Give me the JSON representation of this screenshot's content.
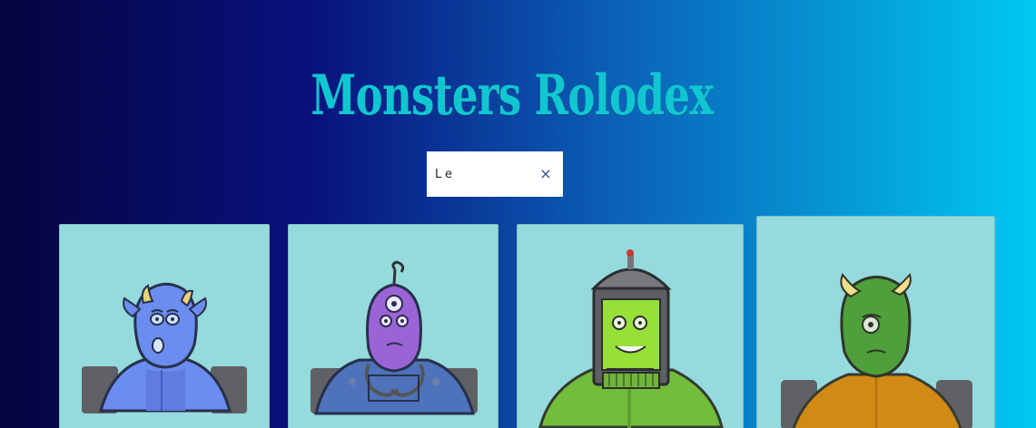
{
  "app": {
    "title": "Monsters Rolodex"
  },
  "search": {
    "value": "Le",
    "clear_symbol": "×"
  },
  "colors": {
    "title": "#10c7d0",
    "card_background": "#95dadd"
  },
  "cards": [
    {
      "image_icon": "monster-blue-image",
      "image_alt": ""
    },
    {
      "image_icon": "monster-purple-image",
      "image_alt": ""
    },
    {
      "image_icon": "monster-green-robot-image",
      "image_alt": ""
    },
    {
      "image_icon": "monster-green-horned-image",
      "image_alt": ""
    }
  ]
}
